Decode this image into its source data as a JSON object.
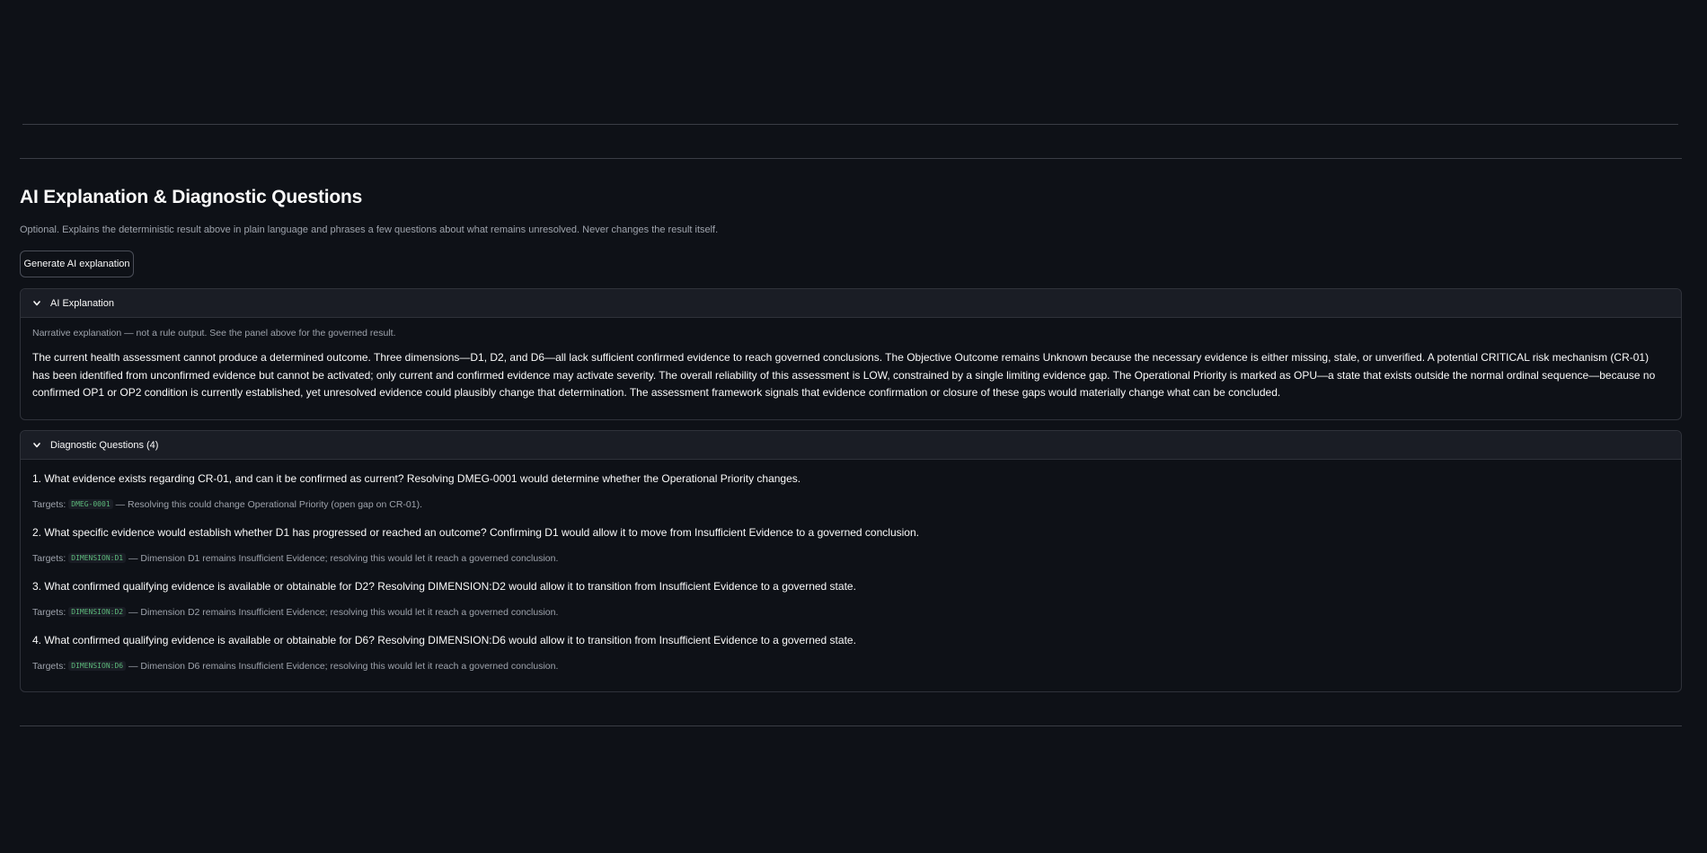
{
  "section": {
    "title": "AI Explanation & Diagnostic Questions",
    "subtitle": "Optional. Explains the deterministic result above in plain language and phrases a few questions about what remains unresolved. Never changes the result itself.",
    "generate_button": "Generate AI explanation"
  },
  "ai_explanation": {
    "header": "AI Explanation",
    "caption": "Narrative explanation — not a rule output. See the panel above for the governed result.",
    "narrative": "The current health assessment cannot produce a determined outcome. Three dimensions—D1, D2, and D6—all lack sufficient confirmed evidence to reach governed conclusions. The Objective Outcome remains Unknown because the necessary evidence is either missing, stale, or unverified. A potential CRITICAL risk mechanism (CR-01) has been identified from unconfirmed evidence but cannot be activated; only current and confirmed evidence may activate severity. The overall reliability of this assessment is LOW, constrained by a single limiting evidence gap. The Operational Priority is marked as OPU—a state that exists outside the normal ordinal sequence—because no confirmed OP1 or OP2 condition is currently established, yet unresolved evidence could plausibly change that determination. The assessment framework signals that evidence confirmation or closure of these gaps would materially change what can be concluded."
  },
  "diagnostic_questions": {
    "header": "Diagnostic Questions (4)",
    "targets_label": "Targets:",
    "items": [
      {
        "question": "1. What evidence exists regarding CR-01, and can it be confirmed as current? Resolving DMEG-0001 would determine whether the Operational Priority changes.",
        "target": "DMEG-0001",
        "note": "— Resolving this could change Operational Priority (open gap on CR-01)."
      },
      {
        "question": "2. What specific evidence would establish whether D1 has progressed or reached an outcome? Confirming D1 would allow it to move from Insufficient Evidence to a governed conclusion.",
        "target": "DIMENSION:D1",
        "note": "— Dimension D1 remains Insufficient Evidence; resolving this would let it reach a governed conclusion."
      },
      {
        "question": "3. What confirmed qualifying evidence is available or obtainable for D2? Resolving DIMENSION:D2 would allow it to transition from Insufficient Evidence to a governed state.",
        "target": "DIMENSION:D2",
        "note": "— Dimension D2 remains Insufficient Evidence; resolving this would let it reach a governed conclusion."
      },
      {
        "question": "4. What confirmed qualifying evidence is available or obtainable for D6? Resolving DIMENSION:D6 would allow it to transition from Insufficient Evidence to a governed state.",
        "target": "DIMENSION:D6",
        "note": "— Dimension D6 remains Insufficient Evidence; resolving this would let it reach a governed conclusion."
      }
    ]
  },
  "colors": {
    "background": "#0e1117",
    "text": "#fafafa",
    "muted": "#9ea3ac",
    "code": "#5cb87a",
    "header_bg": "#1a1d25",
    "border": "#2f323a"
  },
  "icons": {
    "expander": "chevron-down-icon"
  }
}
